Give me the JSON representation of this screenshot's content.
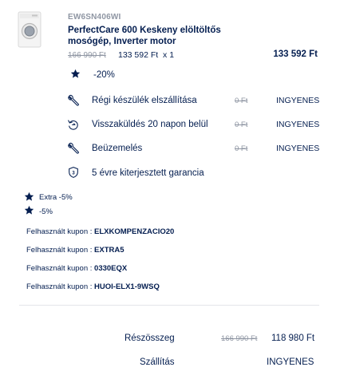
{
  "product": {
    "sku": "EW6SN406WI",
    "name": "PerfectCare 600 Keskeny elöltöltős mosógép, Inverter motor",
    "old_price": "166 990 Ft",
    "unit_price": "133 592 Ft",
    "quantity": "x 1",
    "total": "133 592 Ft",
    "image_icon": "washing-machine"
  },
  "discount": {
    "label": "-20%",
    "icon": "star"
  },
  "services": [
    {
      "label": "Régi készülék elszállítása",
      "old": "0 Ft",
      "value": "INGYENES",
      "icon": "wrench"
    },
    {
      "label": "Visszaküldés 20 napon belül",
      "old": "0 Ft",
      "value": "INGYENES",
      "icon": "return-arrow"
    },
    {
      "label": "Beüzemelés",
      "old": "0 Ft",
      "value": "INGYENES",
      "icon": "wrench"
    },
    {
      "label": "5 évre kiterjesztett garancia",
      "icon": "shield-3"
    }
  ],
  "promos": [
    {
      "label": "Extra -5%",
      "icon": "star"
    },
    {
      "label": "-5%",
      "icon": "star"
    }
  ],
  "coupons": [
    {
      "prefix": "Felhasznált kupon :",
      "code": "ELXKOMPENZACIO20"
    },
    {
      "prefix": "Felhasznált kupon :",
      "code": "EXTRA5"
    },
    {
      "prefix": "Felhasznált kupon :",
      "code": "0330EQX"
    },
    {
      "prefix": "Felhasznált kupon :",
      "code": "HUOI-ELX1-9WSQ"
    }
  ],
  "summary": {
    "subtotal_label": "Részösszeg",
    "subtotal_old": "166 990 Ft",
    "subtotal_value": "118 980 Ft",
    "shipping_label": "Szállítás",
    "shipping_value": "INGYENES"
  },
  "colors": {
    "navy": "#041e50",
    "grey": "#8f96a3",
    "divider": "#e3e5ea"
  }
}
